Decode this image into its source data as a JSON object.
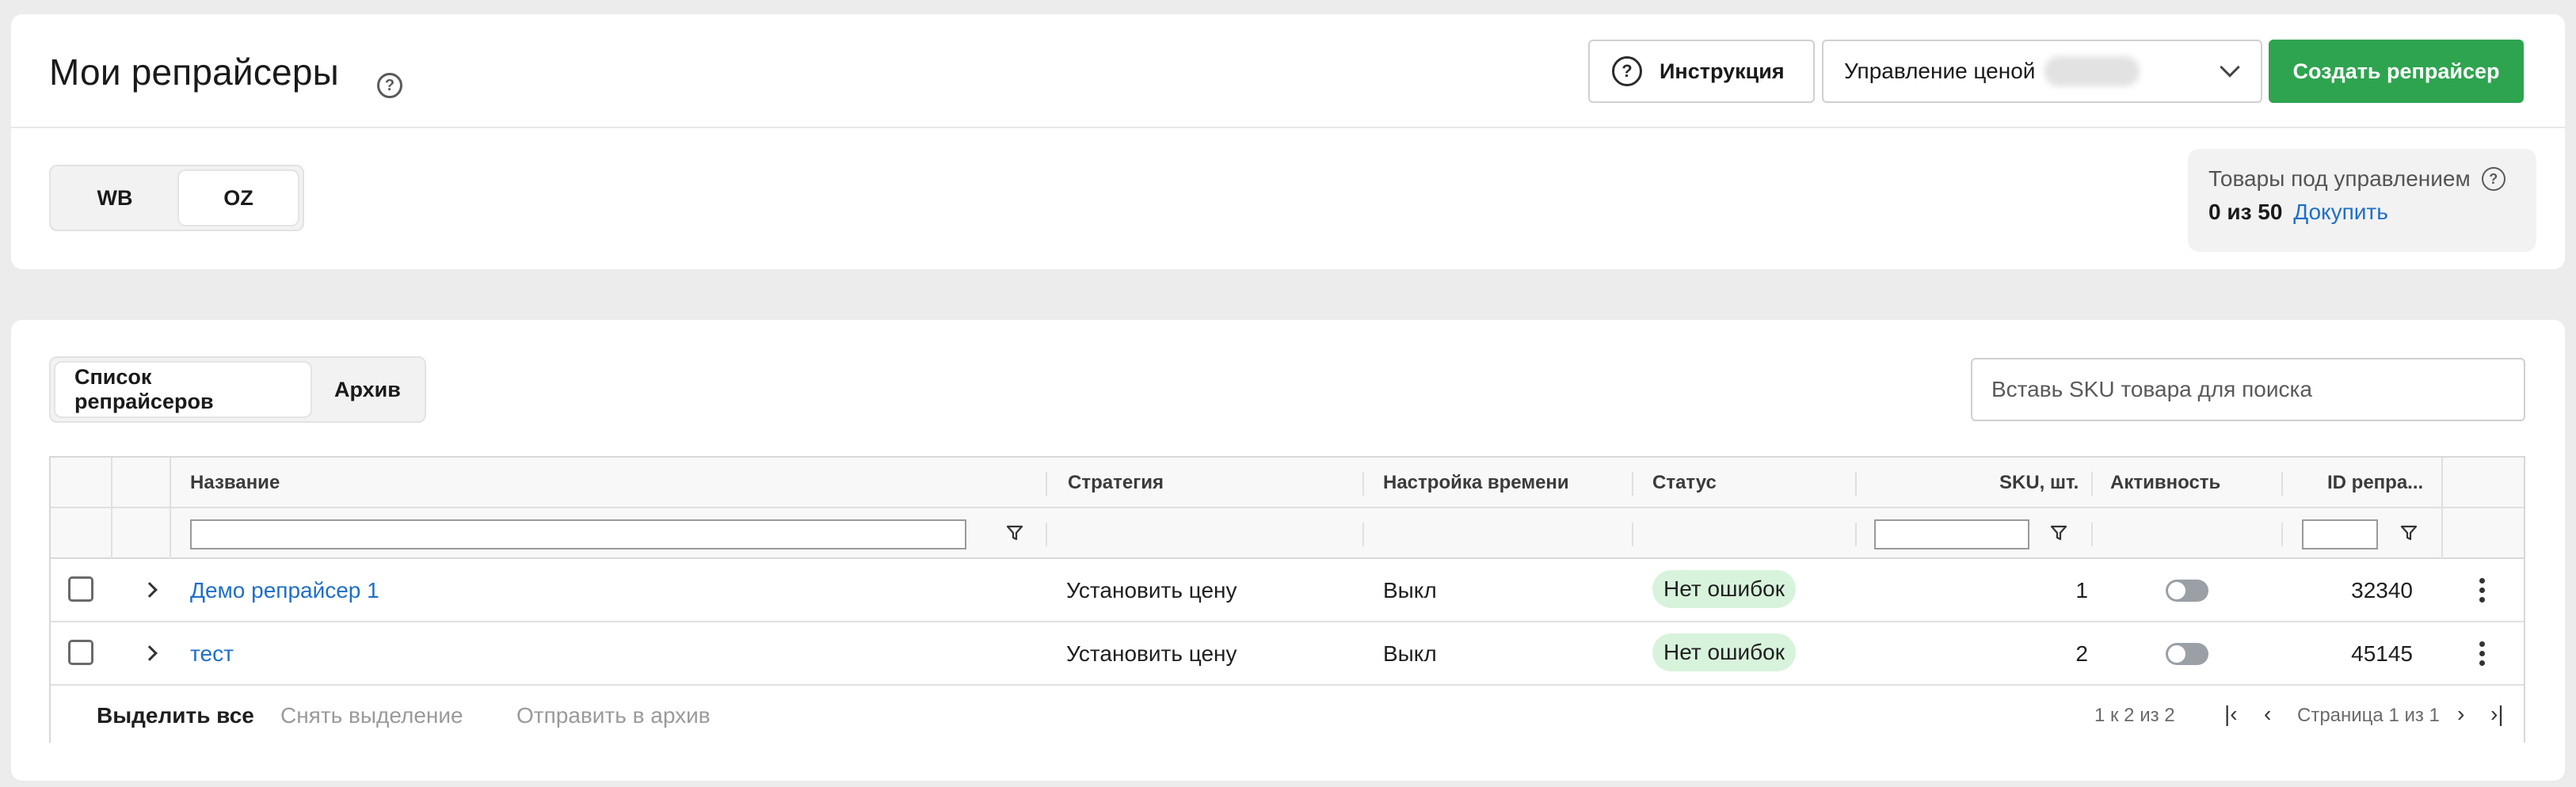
{
  "header": {
    "title": "Мои репрайсеры",
    "instructions_label": "Инструкция",
    "price_select_label": "Управление ценой",
    "create_button_label": "Создать репрайсер"
  },
  "marketplace_tabs": [
    {
      "label": "WB",
      "active": false
    },
    {
      "label": "OZ",
      "active": true
    }
  ],
  "managed": {
    "title": "Товары под управлением",
    "count": "0 из 50",
    "buy_more": "Докупить"
  },
  "list_tabs": [
    {
      "label": "Список репрайсеров",
      "active": true
    },
    {
      "label": "Архив",
      "active": false
    }
  ],
  "search": {
    "placeholder": "Вставь SKU товара для поиска"
  },
  "table": {
    "columns": {
      "name": "Название",
      "strategy": "Стратегия",
      "time": "Настройка времени",
      "status": "Статус",
      "sku": "SKU, шт.",
      "active": "Активность",
      "id": "ID репра..."
    },
    "rows": [
      {
        "name": "Демо репрайсер 1",
        "strategy": "Установить цену",
        "time": "Выкл",
        "status": "Нет ошибок",
        "sku": "1",
        "active": false,
        "id": "32340"
      },
      {
        "name": "тест",
        "strategy": "Установить цену",
        "time": "Выкл",
        "status": "Нет ошибок",
        "sku": "2",
        "active": false,
        "id": "45145"
      }
    ]
  },
  "footer": {
    "select_all": "Выделить все",
    "deselect": "Снять выделение",
    "archive": "Отправить в архив",
    "range": "1 к 2 из 2",
    "page": "Страница 1 из 1"
  },
  "colors": {
    "accent_green": "#2ea44f",
    "link_blue": "#1e6fc8",
    "status_ok_bg": "#d8f3dc"
  }
}
